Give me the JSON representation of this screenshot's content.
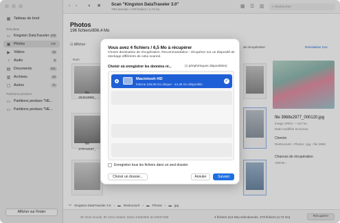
{
  "sidebar": {
    "items": [
      {
        "label": "Tableau de bord",
        "count": "",
        "icon": "dashboard-icon",
        "glyph": "▦"
      },
      {
        "label": "Kingston DataTraveler 3.0",
        "count": "479",
        "icon": "drive-icon",
        "glyph": "▭"
      },
      {
        "label": "Photos",
        "count": "196",
        "icon": "photo-icon",
        "glyph": "▣"
      },
      {
        "label": "Vidéos",
        "count": "19",
        "icon": "video-icon",
        "glyph": "▶"
      },
      {
        "label": "Audio",
        "count": "9",
        "icon": "audio-icon",
        "glyph": "♪"
      },
      {
        "label": "Documents",
        "count": "161",
        "icon": "document-icon",
        "glyph": "▤"
      },
      {
        "label": "Archives",
        "count": "23",
        "icon": "archive-icon",
        "glyph": "▥"
      },
      {
        "label": "Autres",
        "count": "71",
        "icon": "other-icon",
        "glyph": "▢"
      },
      {
        "label": "Partitions perdues \"NE...",
        "count": "",
        "icon": "partition-icon",
        "glyph": "▭"
      },
      {
        "label": "Partitions perdues \"NE...",
        "count": "",
        "icon": "partition-icon",
        "glyph": "▭"
      }
    ],
    "section_results": "Résultats",
    "section_lost": "Partitions perdues",
    "finder_button": "Afficher sur Finder"
  },
  "toolbar": {
    "scan_title": "Scan \"Kingston DataTraveler 3.0\"",
    "scan_sub": "79% terminé • 479 fichiers / 4,74 Go",
    "search_placeholder": "Rechercher"
  },
  "main": {
    "title": "Photos",
    "subtitle": "196 fichiers/806,4 Mo",
    "filter_label": "Afficher",
    "filter_right": "de récupération",
    "reset_link": "Réinitialiser tout",
    "col_head": "Nom",
    "thumbs": [
      {
        "name": "file",
        "size": "2640x3960_"
      },
      {
        "name": "file",
        "size": "2797x4187_"
      },
      {
        "name": "",
        "size": ""
      }
    ]
  },
  "status": {
    "path": [
      "Kingston DataTraveler 3.0",
      "Restructuré",
      "Photos",
      "jpg"
    ]
  },
  "bottom": {
    "info": "0h 4min écoulé, 0h 1min restant, block 44494802 de 60537466",
    "selection": "4 fichiers (6,5 Mo) sélectionnés, 479 fichiers (4,74 Go)",
    "recover_button": "Récupérer"
  },
  "preview": {
    "filename": "file 3968x2977_000120.jpg",
    "type": "Image JPEG — 517 ko",
    "modified": "Date modifiée  Inconnue",
    "path_head": "Chemin",
    "path_value": "Restructuré › Photos › jpg › file 2968",
    "chances_head": "Chances de récupération",
    "chances_value": "Attente..."
  },
  "modal": {
    "title": "Vous avez 4 fichiers / 6,5 Mo à récupérer",
    "description": "Choisir destination de récupération. Recommandation : récupérez sur un dispositif de stockage différents de celui scanné.",
    "question": "Choisir où enregistrer les données ré...",
    "peripherals": "(1 périphériques disponibles)",
    "drive_name": "Macintosh HD",
    "drive_info": "Interne 245,08 Go disque - 44,46 Go disponible",
    "checkbox_label": "Enregistrer tous les fichiers dans un seul dossier",
    "choose_folder": "Choisir un dossier...",
    "cancel": "Annuler",
    "next": "Suivant"
  }
}
